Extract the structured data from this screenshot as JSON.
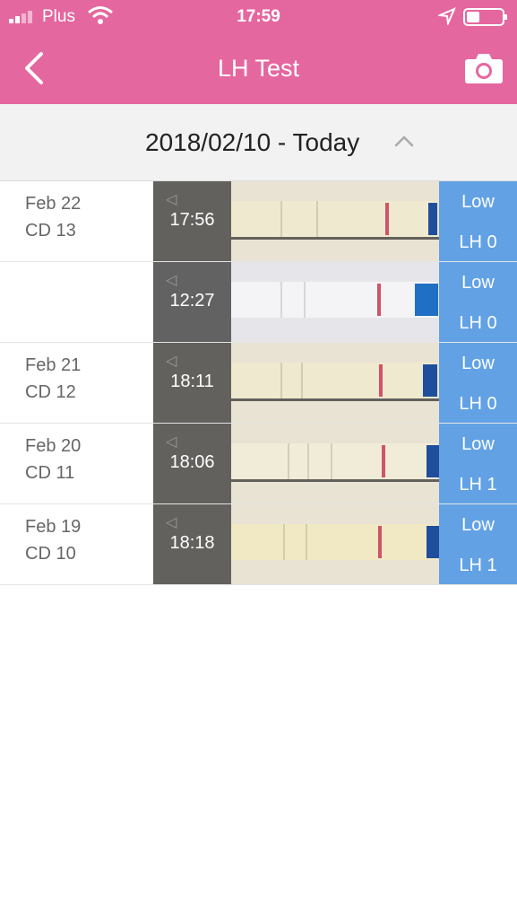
{
  "status_bar": {
    "carrier": "Plus",
    "time": "17:59"
  },
  "nav": {
    "title": "LH Test",
    "back_icon": "chevron-left-icon",
    "camera_icon": "camera-icon"
  },
  "date_range": {
    "text": "2018/02/10 - Today",
    "toggle_icon": "chevron-up-icon"
  },
  "colors": {
    "header": "#e5679f",
    "result_panel": "#62a2e4",
    "test_line": "#d25268"
  },
  "tests": [
    {
      "date": "Feb 22",
      "cycle_day": "CD 13",
      "time": "17:56",
      "level": "Low",
      "lh": "LH 0"
    },
    {
      "date": "",
      "cycle_day": "",
      "time": "12:27",
      "level": "Low",
      "lh": "LH 0"
    },
    {
      "date": "Feb 21",
      "cycle_day": "CD 12",
      "time": "18:11",
      "level": "Low",
      "lh": "LH 0"
    },
    {
      "date": "Feb 20",
      "cycle_day": "CD 11",
      "time": "18:06",
      "level": "Low",
      "lh": "LH 1"
    },
    {
      "date": "Feb 19",
      "cycle_day": "CD 10",
      "time": "18:18",
      "level": "Low",
      "lh": "LH 1"
    }
  ]
}
